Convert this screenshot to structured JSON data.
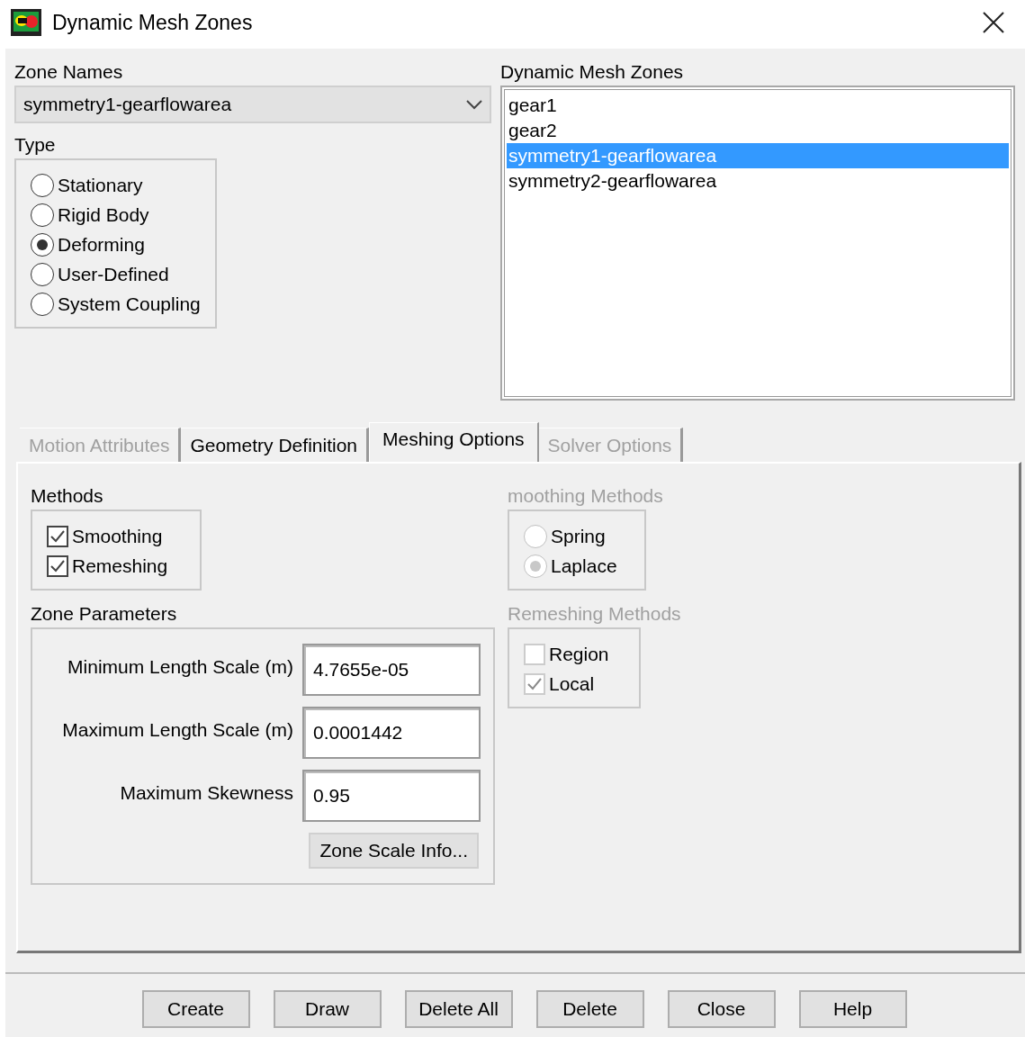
{
  "window": {
    "title": "Dynamic Mesh Zones"
  },
  "zone_names": {
    "label": "Zone Names",
    "value": "symmetry1-gearflowarea"
  },
  "type": {
    "label": "Type",
    "options": [
      {
        "label": "Stationary",
        "selected": false
      },
      {
        "label": "Rigid Body",
        "selected": false
      },
      {
        "label": "Deforming",
        "selected": true
      },
      {
        "label": "User-Defined",
        "selected": false
      },
      {
        "label": "System Coupling",
        "selected": false
      }
    ]
  },
  "dynamic_mesh_zones": {
    "label": "Dynamic Mesh Zones",
    "items": [
      {
        "label": "gear1",
        "selected": false
      },
      {
        "label": "gear2",
        "selected": false
      },
      {
        "label": "symmetry1-gearflowarea",
        "selected": true
      },
      {
        "label": "symmetry2-gearflowarea",
        "selected": false
      }
    ]
  },
  "tabs": [
    {
      "label": "Motion Attributes",
      "selected": false,
      "disabled": true
    },
    {
      "label": "Geometry Definition",
      "selected": false,
      "disabled": false
    },
    {
      "label": "Meshing Options",
      "selected": true,
      "disabled": false
    },
    {
      "label": "Solver Options",
      "selected": false,
      "disabled": true
    }
  ],
  "methods": {
    "label": "Methods",
    "items": [
      {
        "label": "Smoothing",
        "checked": true
      },
      {
        "label": "Remeshing",
        "checked": true
      }
    ]
  },
  "zone_parameters": {
    "label": "Zone Parameters",
    "fields": [
      {
        "label": "Minimum Length Scale (m)",
        "value": "4.7655e-05"
      },
      {
        "label": "Maximum Length Scale (m)",
        "value": "0.0001442"
      },
      {
        "label": "Maximum Skewness",
        "value": "0.95"
      }
    ],
    "button": "Zone Scale Info..."
  },
  "smoothing_methods": {
    "label": "moothing Methods",
    "disabled": true,
    "options": [
      {
        "label": "Spring",
        "selected": false
      },
      {
        "label": "Laplace",
        "selected": true
      }
    ]
  },
  "remeshing_methods": {
    "label": "Remeshing Methods",
    "disabled": true,
    "items": [
      {
        "label": "Region",
        "checked": false
      },
      {
        "label": "Local",
        "checked": true
      }
    ]
  },
  "buttons": [
    "Create",
    "Draw",
    "Delete All",
    "Delete",
    "Close",
    "Help"
  ]
}
